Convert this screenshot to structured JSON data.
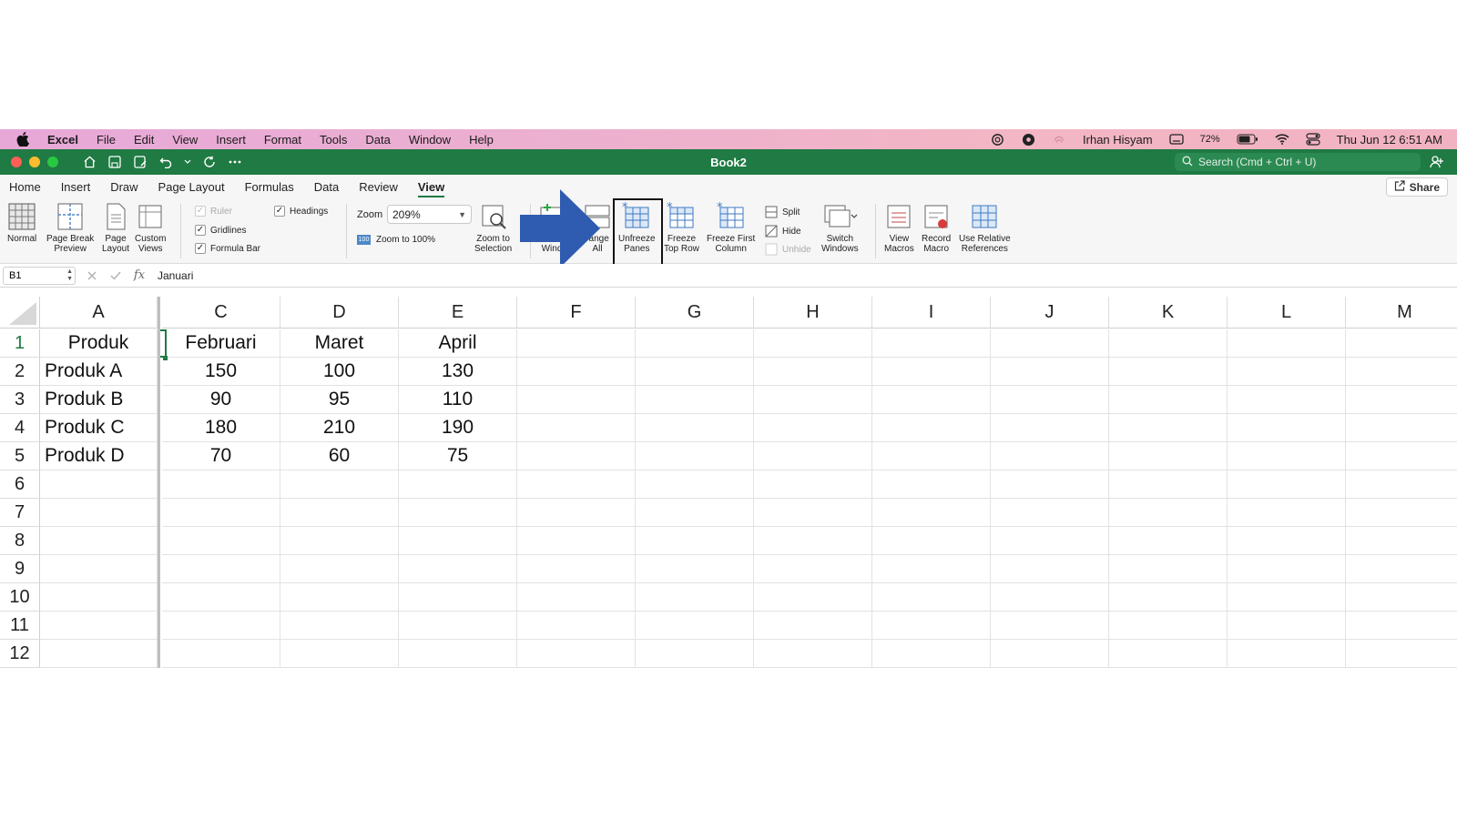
{
  "menubar": {
    "app": "Excel",
    "items": [
      "File",
      "Edit",
      "View",
      "Insert",
      "Format",
      "Tools",
      "Data",
      "Window",
      "Help"
    ],
    "user": "Irhan Hisyam",
    "battery": "72%",
    "datetime": "Thu Jun 12  6:51 AM"
  },
  "titlebar": {
    "doc_title": "Book2",
    "search_placeholder": "Search (Cmd + Ctrl + U)"
  },
  "ribbon_tabs": {
    "tabs": [
      "Home",
      "Insert",
      "Draw",
      "Page Layout",
      "Formulas",
      "Data",
      "Review",
      "View"
    ],
    "active": "View",
    "share": "Share"
  },
  "ribbon": {
    "normal": "Normal",
    "page_break_1": "Page Break",
    "page_break_2": "Preview",
    "page_layout_1": "Page",
    "page_layout_2": "Layout",
    "custom_views_1": "Custom",
    "custom_views_2": "Views",
    "ruler": "Ruler",
    "gridlines": "Gridlines",
    "formula_bar": "Formula Bar",
    "headings": "Headings",
    "zoom_label": "Zoom",
    "zoom_value": "209%",
    "zoom_100": "Zoom to 100%",
    "zoom_sel_1": "Zoom to",
    "zoom_sel_2": "Selection",
    "new_window_partial": "Wind",
    "arrange_1": "range",
    "arrange_2": "All",
    "unfreeze_1": "Unfreeze",
    "unfreeze_2": "Panes",
    "freeze_row_1": "Freeze",
    "freeze_row_2": "Top Row",
    "freeze_col_1": "Freeze First",
    "freeze_col_2": "Column",
    "split": "Split",
    "hide": "Hide",
    "unhide": "Unhide",
    "switch_1": "Switch",
    "switch_2": "Windows",
    "macros_1": "View",
    "macros_2": "Macros",
    "record_1": "Record",
    "record_2": "Macro",
    "relative_1": "Use Relative",
    "relative_2": "References"
  },
  "formula_bar": {
    "name_box": "B1",
    "fx": "fx",
    "value": "Januari"
  },
  "grid": {
    "columns": [
      "A",
      "C",
      "D",
      "E",
      "F",
      "G",
      "H",
      "I",
      "J",
      "K",
      "L",
      "M"
    ],
    "rows": [
      "1",
      "2",
      "3",
      "4",
      "5",
      "6",
      "7",
      "8",
      "9",
      "10",
      "11",
      "12"
    ],
    "cells": [
      [
        "Produk",
        "Februari",
        "Maret",
        "April"
      ],
      [
        "Produk A",
        "150",
        "100",
        "130"
      ],
      [
        "Produk B",
        "90",
        "95",
        "110"
      ],
      [
        "Produk C",
        "180",
        "210",
        "190"
      ],
      [
        "Produk D",
        "70",
        "60",
        "75"
      ]
    ]
  },
  "colors": {
    "excel_green": "#1f7a43",
    "arrow_blue": "#2f5bb0"
  }
}
